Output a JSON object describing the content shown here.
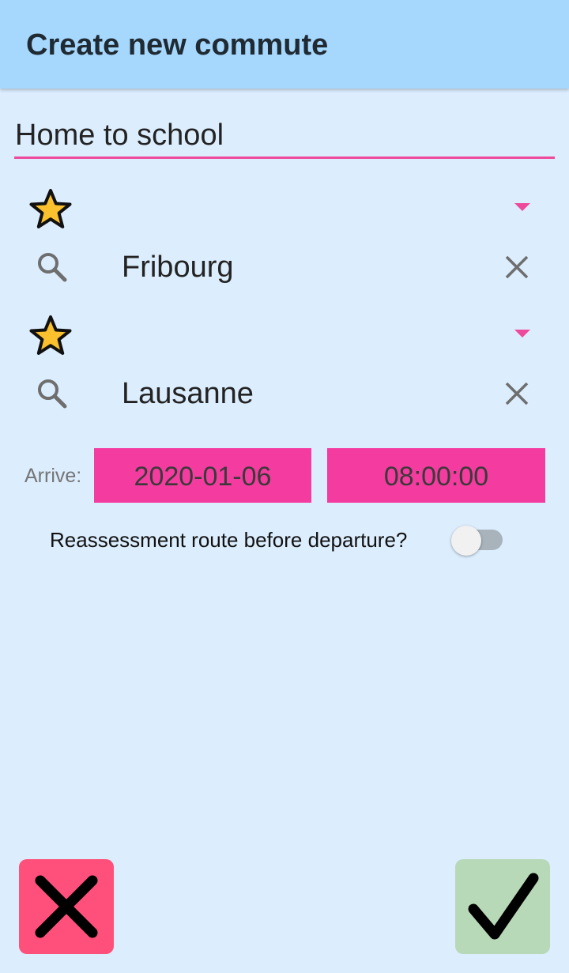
{
  "header": {
    "title": "Create new commute"
  },
  "commute": {
    "name": "Home to school"
  },
  "origin": {
    "value": "Fribourg"
  },
  "destination": {
    "value": "Lausanne"
  },
  "arrive": {
    "label": "Arrive:",
    "date": "2020-01-06",
    "time": "08:00:00"
  },
  "reassess": {
    "label": "Reassessment route before departure?",
    "enabled": false
  },
  "icons": {
    "favorite": "star-icon",
    "search": "search-icon",
    "clear": "close-icon",
    "dropdown": "dropdown-arrow-icon",
    "cancel": "x-icon",
    "confirm": "check-icon"
  },
  "colors": {
    "appbar": "#a6d7fd",
    "background": "#dcedfd",
    "accent": "#ee4a9b",
    "pink_button": "#f43b9f",
    "cancel": "#fe507b",
    "confirm": "#b8d9b8",
    "star": "#fbc02d"
  }
}
